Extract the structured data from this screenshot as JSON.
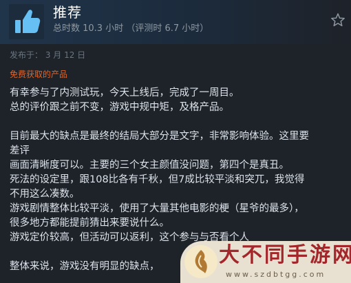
{
  "review": {
    "verdict": "推荐",
    "hours": "总时数 10.3 小时 （评测时 6.7 小时）",
    "posted": "发布于： 3 月 12 日",
    "free_product": "免费获取的产品",
    "lines": [
      "有幸参与了内测试玩，今天上线后，完成了一周目。",
      "总的评价跟之前不变，游戏中规中矩，及格产品。",
      "",
      "目前最大的缺点是最终的结局大部分是文字，非常影响体验。这里要",
      "差评",
      "画面清晰度可以。主要的三个女主颜值没问题，第四个是真丑。",
      "死法的设定里，跟108比各有千秋，但7成比较平淡和突兀，我觉得",
      "不用这么凑数。",
      "游戏剧情整体比较平淡，使用了大量其他电影的梗（星爷的最多），",
      "很多地方都能提前猜出来要说什么。",
      "游戏定价较高，但活动可以返利，这个参与与否看个人",
      "",
      "整体来说，游戏没有明显的缺点，"
    ]
  },
  "icons": {
    "thumb": "thumbs-up-icon",
    "star": "star-outline-icon"
  },
  "watermark": {
    "title": "大不同手游网",
    "url": "www.szdbtgg.com"
  },
  "colors": {
    "background": "#1e2229",
    "thumb_blue": "#66c0f4",
    "free_orange": "#e0652a",
    "watermark_red": "#a3262a"
  }
}
